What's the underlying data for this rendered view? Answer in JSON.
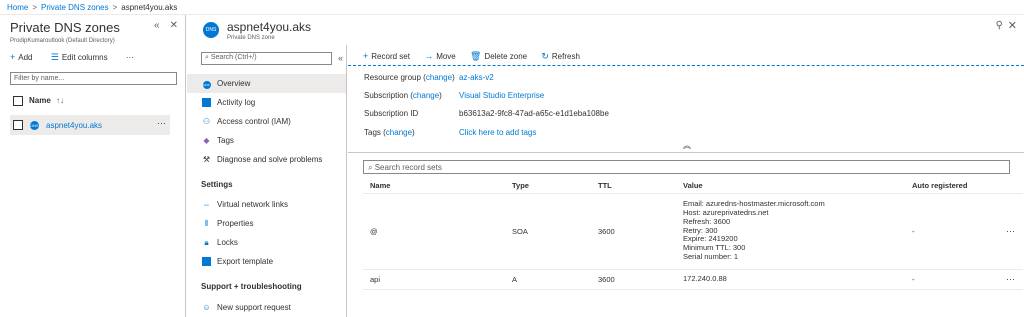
{
  "breadcrumb": {
    "home": "Home",
    "zones": "Private DNS zones",
    "current": "aspnet4you.aks"
  },
  "left_pane": {
    "title": "Private DNS zones",
    "subtitle": "ProdipKumaroutlook (Default Directory)",
    "add_label": "Add",
    "edit_columns_label": "Edit columns",
    "more": "···",
    "filter_placeholder": "Filter by name...",
    "column_name": "Name",
    "sort_icon": "↑↓",
    "items": [
      {
        "icon_text": "DNS",
        "label": "aspnet4you.aks",
        "more": "···"
      }
    ]
  },
  "resource": {
    "icon_text": "DNS",
    "title": "aspnet4you.aks",
    "subtitle": "Private DNS zone"
  },
  "nav": {
    "search_placeholder": "Search (Ctrl+/)",
    "items_top": [
      {
        "label": "Overview"
      },
      {
        "label": "Activity log"
      },
      {
        "label": "Access control (IAM)"
      },
      {
        "label": "Tags"
      },
      {
        "label": "Diagnose and solve problems"
      }
    ],
    "settings_header": "Settings",
    "items_settings": [
      {
        "label": "Virtual network links"
      },
      {
        "label": "Properties"
      },
      {
        "label": "Locks"
      },
      {
        "label": "Export template"
      }
    ],
    "support_header": "Support + troubleshooting",
    "items_support": [
      {
        "label": "New support request"
      }
    ]
  },
  "toolbar": {
    "record_set": "Record set",
    "move": "Move",
    "delete_zone": "Delete zone",
    "refresh": "Refresh"
  },
  "essentials": {
    "resource_group_label": "Resource group",
    "subscription_label": "Subscription",
    "change": "change",
    "resource_group_value": "az-aks-v2",
    "subscription_value": "Visual Studio Enterprise",
    "subscription_id_label": "Subscription ID",
    "subscription_id_value": "b63613a2-9fc8-47ad-a65c-e1d1eba108be",
    "tags_label": "Tags",
    "tags_value": "Click here to add tags"
  },
  "records": {
    "search_placeholder": "Search record sets",
    "columns": [
      "Name",
      "Type",
      "TTL",
      "Value",
      "Auto registered"
    ],
    "rows": [
      {
        "name": "@",
        "type": "SOA",
        "ttl": "3600",
        "value_lines": [
          "Email: azuredns-hostmaster.microsoft.com",
          "Host: azureprivatedns.net",
          "Refresh: 3600",
          "Retry: 300",
          "Expire: 2419200",
          "Minimum TTL: 300",
          "Serial number: 1"
        ],
        "auto": "-",
        "more": "···"
      },
      {
        "name": "api",
        "type": "A",
        "ttl": "3600",
        "value_lines": [
          "172.240.0.88"
        ],
        "auto": "-",
        "more": "···"
      }
    ]
  },
  "colors": {
    "accent": "#0078d4",
    "selected_bg": "#edebe9"
  }
}
